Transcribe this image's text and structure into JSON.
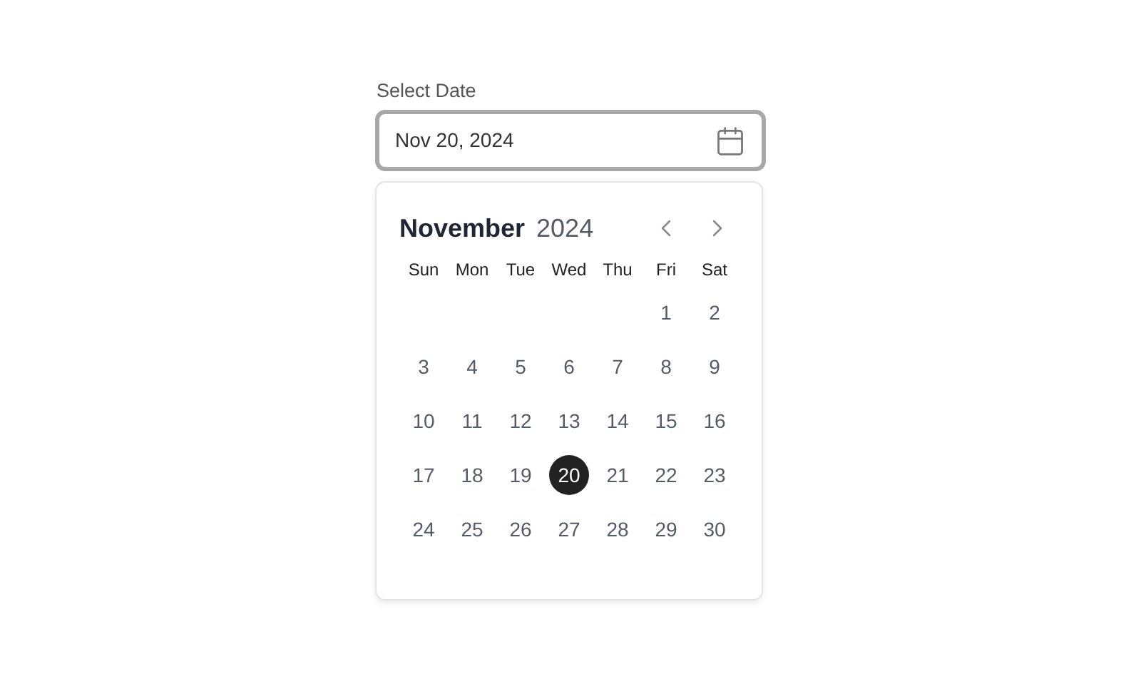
{
  "label": "Select Date",
  "field": {
    "value": "Nov 20, 2024"
  },
  "calendar": {
    "month": "November",
    "year": "2024",
    "weekdays": [
      "Sun",
      "Mon",
      "Tue",
      "Wed",
      "Thu",
      "Fri",
      "Sat"
    ],
    "weeks": [
      [
        {
          "day": "1",
          "selected": false
        },
        {
          "day": "2",
          "selected": false
        }
      ],
      [
        {
          "day": "3",
          "selected": false
        },
        {
          "day": "4",
          "selected": false
        },
        {
          "day": "5",
          "selected": false
        },
        {
          "day": "6",
          "selected": false
        },
        {
          "day": "7",
          "selected": false
        },
        {
          "day": "8",
          "selected": false
        },
        {
          "day": "9",
          "selected": false
        }
      ],
      [
        {
          "day": "10",
          "selected": false
        },
        {
          "day": "11",
          "selected": false
        },
        {
          "day": "12",
          "selected": false
        },
        {
          "day": "13",
          "selected": false
        },
        {
          "day": "14",
          "selected": false
        },
        {
          "day": "15",
          "selected": false
        },
        {
          "day": "16",
          "selected": false
        }
      ],
      [
        {
          "day": "17",
          "selected": false
        },
        {
          "day": "18",
          "selected": false
        },
        {
          "day": "19",
          "selected": false
        },
        {
          "day": "20",
          "selected": true
        },
        {
          "day": "21",
          "selected": false
        },
        {
          "day": "22",
          "selected": false
        },
        {
          "day": "23",
          "selected": false
        }
      ],
      [
        {
          "day": "24",
          "selected": false
        },
        {
          "day": "25",
          "selected": false
        },
        {
          "day": "26",
          "selected": false
        },
        {
          "day": "27",
          "selected": false
        },
        {
          "day": "28",
          "selected": false
        },
        {
          "day": "29",
          "selected": false
        },
        {
          "day": "30",
          "selected": false
        }
      ]
    ]
  }
}
